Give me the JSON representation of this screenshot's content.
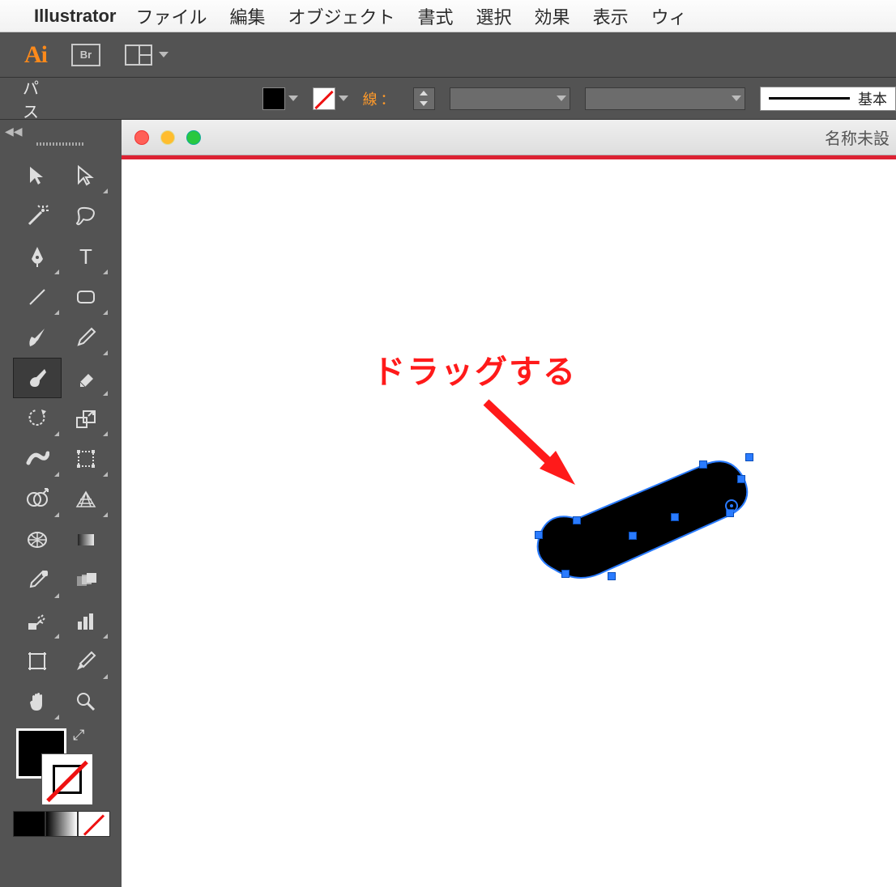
{
  "menubar": {
    "app": "Illustrator",
    "items": [
      "ファイル",
      "編集",
      "オブジェクト",
      "書式",
      "選択",
      "効果",
      "表示",
      "ウィ"
    ]
  },
  "topbar": {
    "ai": "Ai",
    "br": "Br"
  },
  "options": {
    "context_label": "パス",
    "stroke_label": "線：",
    "brush_label": "基本"
  },
  "document": {
    "title": "名称未設"
  },
  "canvas": {
    "annotation": "ドラッグする"
  },
  "tools": {
    "names": [
      "selection-tool",
      "direct-selection-tool",
      "magic-wand-tool",
      "lasso-tool",
      "pen-tool",
      "type-tool",
      "line-tool",
      "rectangle-tool",
      "paintbrush-tool",
      "pencil-tool",
      "blob-brush-tool",
      "eraser-tool",
      "rotate-tool",
      "scale-tool",
      "width-tool",
      "free-transform-tool",
      "shape-builder-tool",
      "perspective-grid-tool",
      "mesh-tool",
      "gradient-tool",
      "eyedropper-tool",
      "blend-tool",
      "symbol-sprayer-tool",
      "column-graph-tool",
      "artboard-tool",
      "slice-tool",
      "hand-tool",
      "zoom-tool"
    ]
  }
}
